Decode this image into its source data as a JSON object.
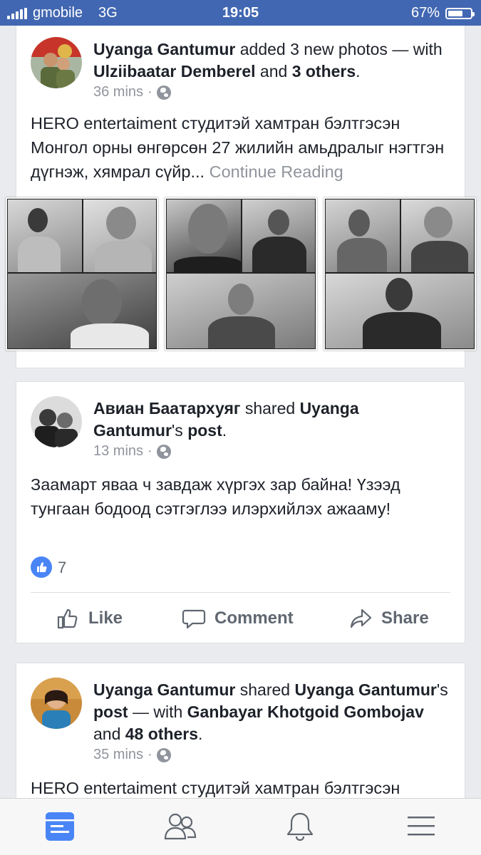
{
  "status_bar": {
    "carrier": "gmobile",
    "network": "3G",
    "time": "19:05",
    "battery_percent": "67%",
    "battery_level": 0.67
  },
  "posts": [
    {
      "author": "Uyanga Gantumur",
      "action": "added 3 new photos —",
      "with_word": "with",
      "tagged": "Ulziibaatar Demberel",
      "and_word": "and",
      "others": "3 others",
      "period": ".",
      "time": "36 mins",
      "separator": "·",
      "privacy_icon": "globe-icon",
      "text": "HERO entertaiment студитэй хамтран бэлтгэсэн Монгол орны өнгөрсөн 27 жилийн амьдралыг нэгтгэн дүгнэж, хямрал сүйр...",
      "continue_label": "Continue Reading"
    },
    {
      "author": "Авиан Баатархуяг",
      "action": "shared",
      "shared_from": "Uyanga Gantumur",
      "possessive": "'s",
      "post_word": "post",
      "period": ".",
      "time": "13 mins",
      "separator": "·",
      "privacy_icon": "globe-icon",
      "text": "Заамарт яваа ч завдаж хүргэх зар байна! Үзээд тунгаан бодоод сэтгэглээ илэрхийлэх ажааму!",
      "likes": "7",
      "actions": {
        "like": "Like",
        "comment": "Comment",
        "share": "Share"
      }
    },
    {
      "author": "Uyanga Gantumur",
      "action": "shared",
      "shared_from": "Uyanga Gantumur",
      "possessive": "'s",
      "post_word": "post",
      "dash_with": "— with",
      "tagged": "Ganbayar Khotgoid Gombojav",
      "and_word": "and",
      "others": "48 others",
      "period": ".",
      "time": "35 mins",
      "separator": "·",
      "privacy_icon": "globe-icon",
      "text": "HERO entertaiment студитэй хамтран бэлтгэсэн"
    }
  ],
  "bottom_nav": [
    "news-feed-icon",
    "friends-icon",
    "notifications-icon",
    "menu-icon"
  ],
  "colors": {
    "brand": "#4267b2",
    "like_blue": "#4a85f6",
    "meta_gray": "#90949c"
  }
}
